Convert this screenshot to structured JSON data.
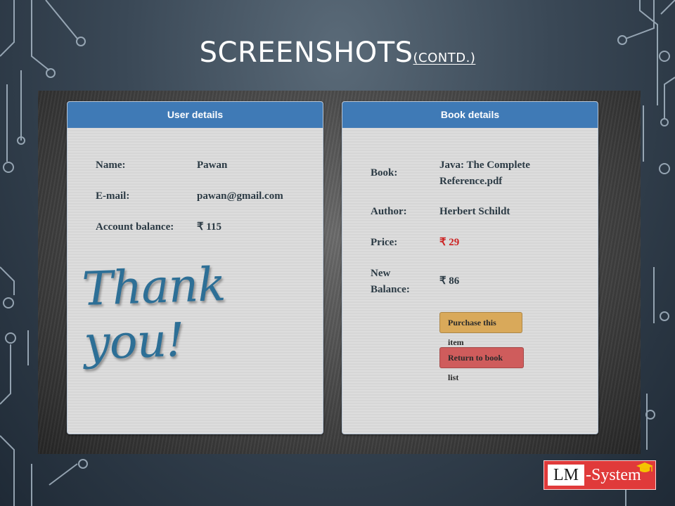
{
  "slide": {
    "title_main": "SCREENSHOTS",
    "title_suffix": "(CONTD.)"
  },
  "user_panel": {
    "header": "User details",
    "name_label": "Name:",
    "name_value": "Pawan",
    "email_label": "E-mail:",
    "email_value": "pawan@gmail.com",
    "balance_label": "Account balance:",
    "balance_value": "₹ 115",
    "thank_you": "Thank you!"
  },
  "book_panel": {
    "header": "Book details",
    "book_label": "Book:",
    "book_value_line1": "Java: The Complete",
    "book_value_line2": "Reference.pdf",
    "author_label": "Author:",
    "author_value": "Herbert Schildt",
    "price_label": "Price:",
    "price_value": "₹ 29",
    "new_balance_label_line1": "New",
    "new_balance_label_line2": "Balance:",
    "new_balance_value": "₹ 86",
    "purchase_button": "Purchase this item",
    "return_button": "Return to book list"
  },
  "logo": {
    "lm": "LM",
    "system": "-System",
    "icon": "graduation-cap-icon"
  },
  "colors": {
    "panel_header": "#3f7ab6",
    "price": "#cc2222",
    "purchase_button": "#d9a95a",
    "return_button": "#cf5c5c",
    "logo_red": "#e03a3a"
  }
}
